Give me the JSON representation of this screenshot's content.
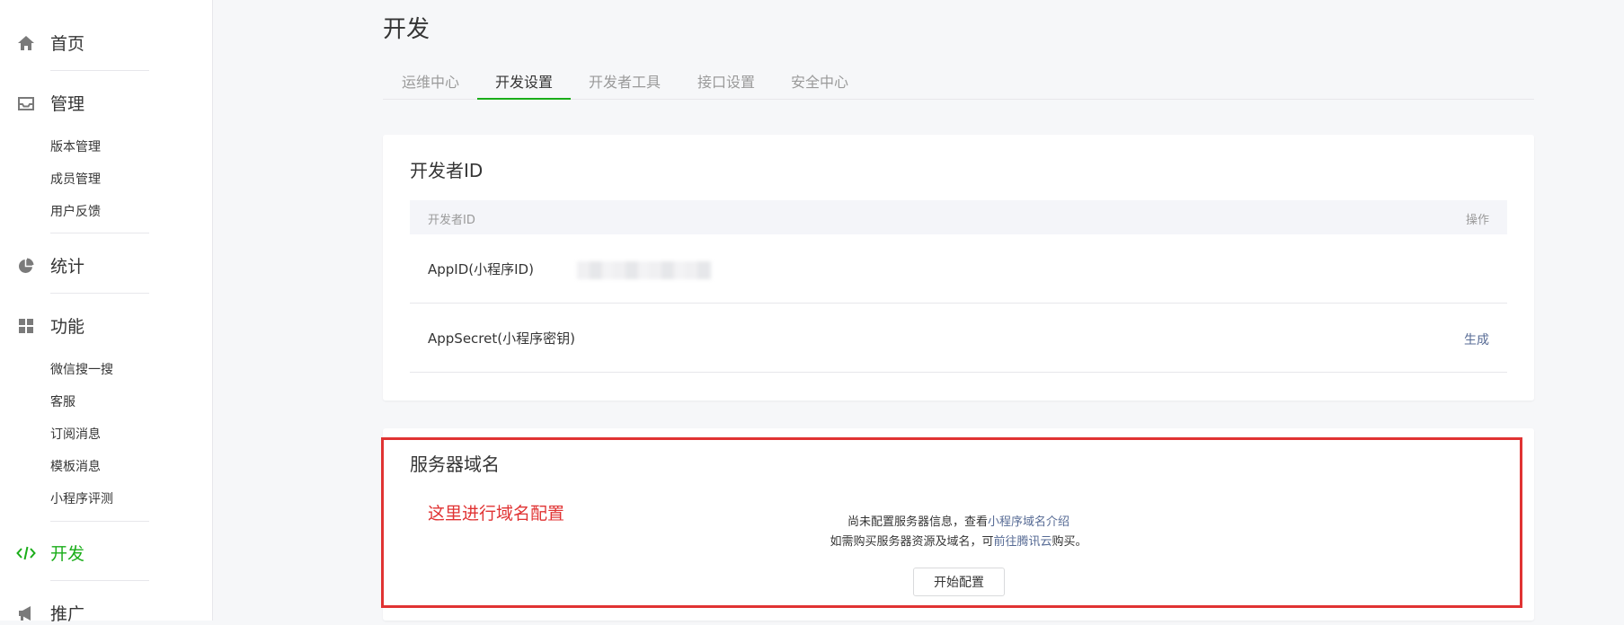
{
  "sidebar": {
    "home": "首页",
    "manage": "管理",
    "manage_items": [
      "版本管理",
      "成员管理",
      "用户反馈"
    ],
    "stats": "统计",
    "features": "功能",
    "feature_items": [
      "微信搜一搜",
      "客服",
      "订阅消息",
      "模板消息",
      "小程序评测"
    ],
    "dev": "开发",
    "promo": "推广"
  },
  "page_title": "开发",
  "tabs": [
    "运维中心",
    "开发设置",
    "开发者工具",
    "接口设置",
    "安全中心"
  ],
  "active_tab": "开发设置",
  "dev_id_card": {
    "title": "开发者ID",
    "col_id": "开发者ID",
    "col_action": "操作",
    "row_appid": "AppID(小程序ID)",
    "row_secret": "AppSecret(小程序密钥)",
    "generate": "生成"
  },
  "server_card": {
    "title": "服务器域名",
    "annotation": "这里进行域名配置",
    "line1_prefix": "尚未配置服务器信息，查看",
    "line1_link": "小程序域名介绍",
    "line2_prefix": "如需购买服务器资源及域名，可",
    "line2_link": "前往腾讯云",
    "line2_suffix": "购买。",
    "button": "开始配置"
  },
  "colors": {
    "accent": "#1aad19",
    "link": "#576b95",
    "annotation": "#e03333"
  }
}
